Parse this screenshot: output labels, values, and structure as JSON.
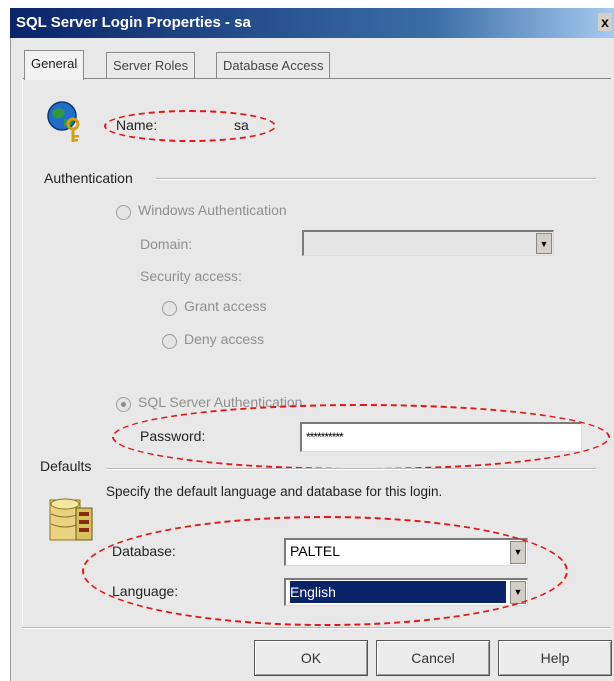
{
  "window": {
    "title": "SQL Server Login Properties - sa",
    "close_glyph": "x"
  },
  "tabs": [
    {
      "label": "General"
    },
    {
      "label": "Server Roles"
    },
    {
      "label": "Database Access"
    }
  ],
  "general": {
    "name_label": "Name:",
    "name_value": "sa",
    "authentication_heading": "Authentication",
    "windows_auth_label": "Windows Authentication",
    "domain_label": "Domain:",
    "security_access_label": "Security access:",
    "grant_access_label": "Grant access",
    "deny_access_label": "Deny access",
    "sql_auth_label": "SQL Server Authentication",
    "password_label": "Password:",
    "password_value": "**********",
    "defaults_heading": "Defaults",
    "defaults_desc": "Specify the default language and database for this login.",
    "database_label": "Database:",
    "database_value": "PALTEL",
    "language_label": "Language:",
    "language_value": "English"
  },
  "buttons": {
    "ok": "OK",
    "cancel": "Cancel",
    "help": "Help"
  },
  "colors": {
    "annotation": "#e01818",
    "titlebar": "#0a246a",
    "selection": "#0a246a"
  },
  "icons": {
    "login": "globe-key-icon",
    "defaults": "database-icon"
  }
}
